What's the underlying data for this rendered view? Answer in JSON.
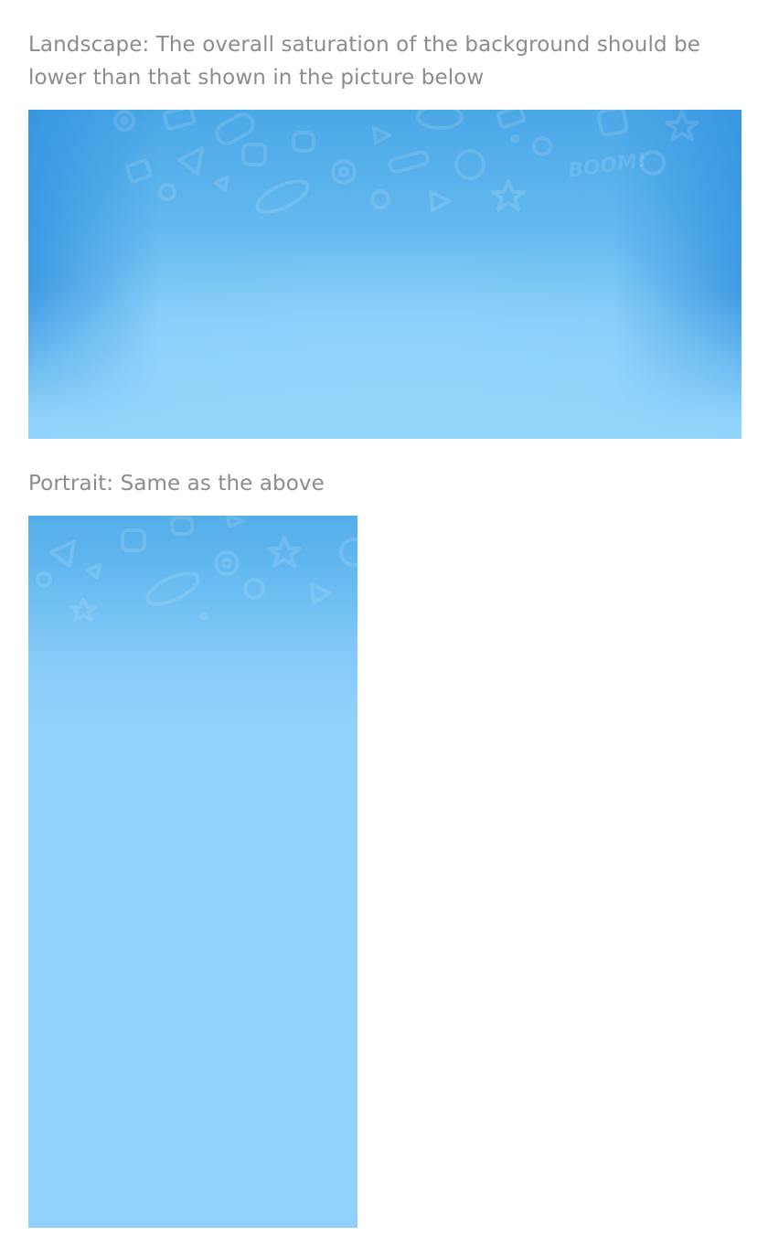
{
  "landscape": {
    "caption": "Landscape: The overall saturation of the background should be lower than that shown in the picture below",
    "decor_text": "BOOM!"
  },
  "portrait": {
    "caption": "Portrait: Same as the above"
  },
  "colors": {
    "caption_text": "#8c8c8c",
    "landscape_top_edge": "#3d98e2",
    "landscape_center": "#93d4fb",
    "portrait_top": "#54aee9",
    "portrait_bottom": "#90d2fb"
  }
}
